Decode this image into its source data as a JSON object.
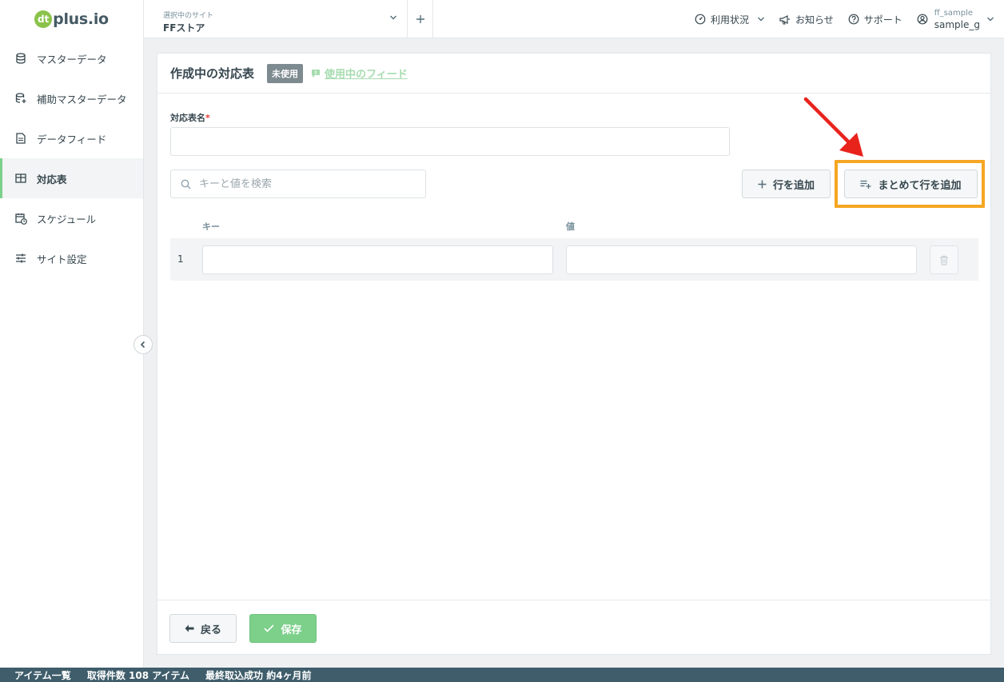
{
  "logo": {
    "mark": "dt",
    "text": "plus.io"
  },
  "sidebar": {
    "items": [
      {
        "label": "マスターデータ",
        "icon": "database-icon"
      },
      {
        "label": "補助マスターデータ",
        "icon": "database-plus-icon"
      },
      {
        "label": "データフィード",
        "icon": "document-icon"
      },
      {
        "label": "対応表",
        "icon": "table-icon",
        "active": true
      },
      {
        "label": "スケジュール",
        "icon": "calendar-clock-icon"
      },
      {
        "label": "サイト設定",
        "icon": "sliders-icon"
      }
    ]
  },
  "header": {
    "site_caption": "選択中のサイト",
    "site_name": "FFストア",
    "usage": "利用状況",
    "news": "お知らせ",
    "support": "サポート",
    "user_id": "ff_sample",
    "user_name": "sample_g"
  },
  "panel": {
    "title": "作成中の対応表",
    "badge": "未使用",
    "feed_link": "使用中のフィード",
    "name_label": "対応表名",
    "required_mark": "*",
    "name_value": "",
    "search_placeholder": "キーと値を検索",
    "add_row": "行を追加",
    "bulk_add_row": "まとめて行を追加",
    "col_key": "キー",
    "col_value": "値",
    "rows": [
      {
        "num": "1",
        "key": "",
        "value": ""
      }
    ],
    "back": "戻る",
    "save": "保存"
  },
  "bottom_bar": {
    "items": [
      "アイテム一覧",
      "取得件数 108 アイテム",
      "最終取込成功 約4ヶ月前"
    ]
  },
  "colors": {
    "accent": "#7cd08a",
    "highlight": "#f5a623",
    "arrow": "#e8231c",
    "bottom_bar": "#3f5d6b"
  }
}
